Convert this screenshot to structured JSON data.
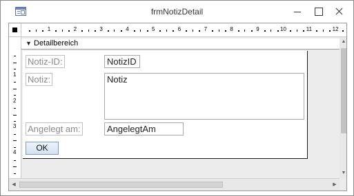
{
  "window": {
    "title": "frmNotizDetail",
    "icons": {
      "app": "form-icon",
      "minimize": "minimize-icon",
      "maximize": "maximize-icon",
      "close": "close-icon"
    }
  },
  "ruler": {
    "horizontal_numbers": [
      "1",
      "2",
      "3",
      "4",
      "5",
      "6",
      "7",
      "8",
      "9",
      "10",
      "11",
      "12"
    ],
    "vertical_numbers": [
      "1",
      "2",
      "3",
      "4"
    ]
  },
  "section": {
    "label": "Detailbereich",
    "icon": "section-arrow-icon"
  },
  "controls": {
    "notiz_id_label": "Notiz-ID:",
    "notiz_id_field": "NotizID",
    "notiz_label": "Notiz:",
    "notiz_field": "Notiz",
    "angelegt_label": "Angelegt am:",
    "angelegt_field": "AngelegtAm",
    "ok_button": "OK"
  },
  "colors": {
    "label_text": "#8a8a8a",
    "button_border": "#7a9cc8",
    "surface": "#ececec"
  }
}
